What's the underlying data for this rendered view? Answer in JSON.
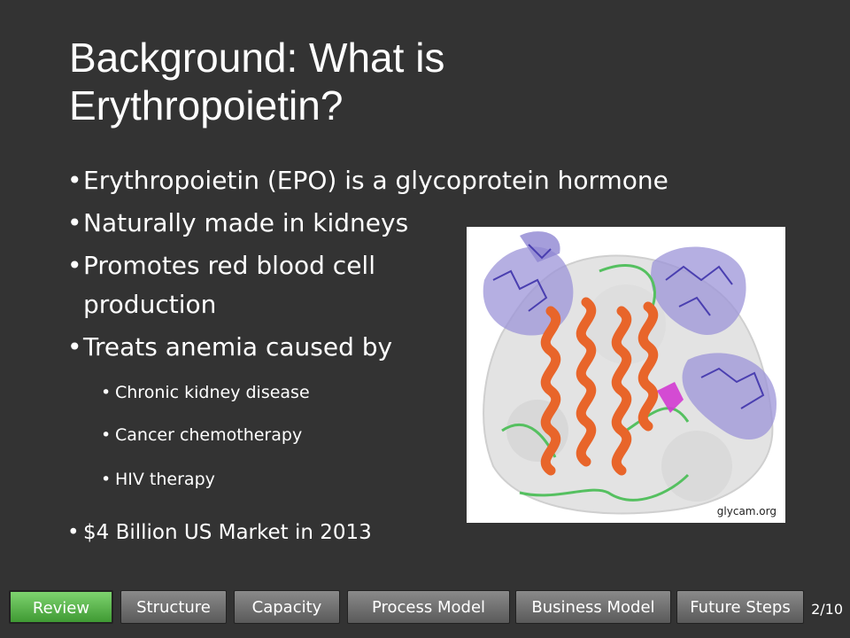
{
  "slide": {
    "title": "Background: What is Erythropoietin?",
    "bullets": [
      "Erythropoietin (EPO) is a glycoprotein hormone",
      "Naturally made in kidneys",
      "Promotes red blood cell",
      "production",
      "Treats anemia caused by"
    ],
    "sub_bullets": [
      "Chronic kidney disease",
      "Cancer chemotherapy",
      "HIV therapy"
    ],
    "market_bullet": "$4 Billion US Market in 2013",
    "bullet_glyph": "•",
    "figure_credit": "glycam.org"
  },
  "nav": {
    "tabs": [
      "Review",
      "Structure",
      "Capacity",
      "Process Model",
      "Business Model",
      "Future Steps"
    ],
    "active_tab": "Review",
    "page": "2/10"
  },
  "colors": {
    "background": "#333333",
    "tab_active": "#5cb84a",
    "tab_inactive": "#707070",
    "helix": "#e8652a",
    "glycan": "#6a5acd",
    "loop": "#55c060"
  }
}
